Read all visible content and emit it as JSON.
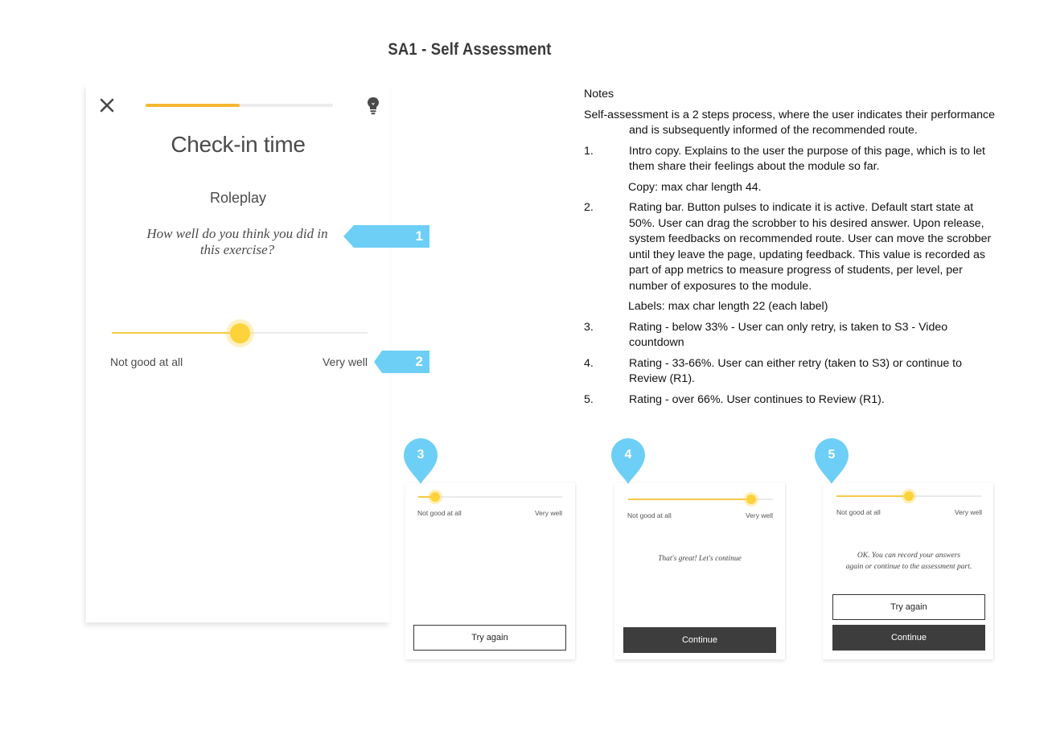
{
  "page_title": "SA1 - Self Assessment",
  "colors": {
    "accent_yellow": "#f7b733",
    "callout_blue": "#6dcff6",
    "dark_button": "#3d3d3d"
  },
  "main_screen": {
    "close_icon": "close-icon",
    "hint_icon": "lightbulb-icon",
    "progress_fraction": 0.5,
    "title": "Check-in time",
    "section": "Roleplay",
    "question": "How well do you think you did in this exercise?",
    "slider": {
      "value_fraction": 0.5,
      "label_left": "Not good at all",
      "label_right": "Very well"
    },
    "callouts": [
      "1",
      "2"
    ]
  },
  "notes": {
    "heading": "Notes",
    "intro": "Self-assessment is a 2 steps process, where the user indicates their performance and is subsequently informed of the recommended route.",
    "items": [
      {
        "num": "1.",
        "text": "Intro copy. Explains to the user the purpose of this page, which is to let them share their feelings about the module so far.",
        "sub": "Copy: max char length 44."
      },
      {
        "num": "2.",
        "text": "Rating bar. Button pulses to indicate it is active. Default start state at 50%. User can drag the scrobber to his desired answer. Upon release, system feedbacks on recommended route. User can move the scrobber until they leave the page, updating feedback. This value is recorded as part of app metrics to measure progress of students, per level, per number of exposures to the module.",
        "sub": "Labels: max char length 22 (each label)"
      },
      {
        "num": "3.",
        "text": "Rating - below 33% - User can only retry, is taken to S3 - Video countdown"
      },
      {
        "num": "4.",
        "text": "Rating - 33-66%. User can either retry (taken to S3) or continue to Review (R1)."
      },
      {
        "num": "5.",
        "text": "Rating - over 66%. User continues to Review (R1)."
      }
    ]
  },
  "variants": [
    {
      "pin": "3",
      "slider_fraction": 0.12,
      "label_left": "Not good at all",
      "label_right": "Very well",
      "message": "",
      "buttons": [
        {
          "label": "Try again",
          "style": "outline"
        }
      ]
    },
    {
      "pin": "4",
      "slider_fraction": 0.85,
      "label_left": "Not good at all",
      "label_right": "Very well",
      "message": "That's great! Let's continue",
      "buttons": [
        {
          "label": "Continue",
          "style": "dark"
        }
      ]
    },
    {
      "pin": "5",
      "slider_fraction": 0.5,
      "label_left": "Not good at all",
      "label_right": "Very well",
      "message_line1": "OK. You can record your answers",
      "message_line2": "again or continue to the assessment part.",
      "buttons": [
        {
          "label": "Try again",
          "style": "outline"
        },
        {
          "label": "Continue",
          "style": "dark"
        }
      ]
    }
  ]
}
